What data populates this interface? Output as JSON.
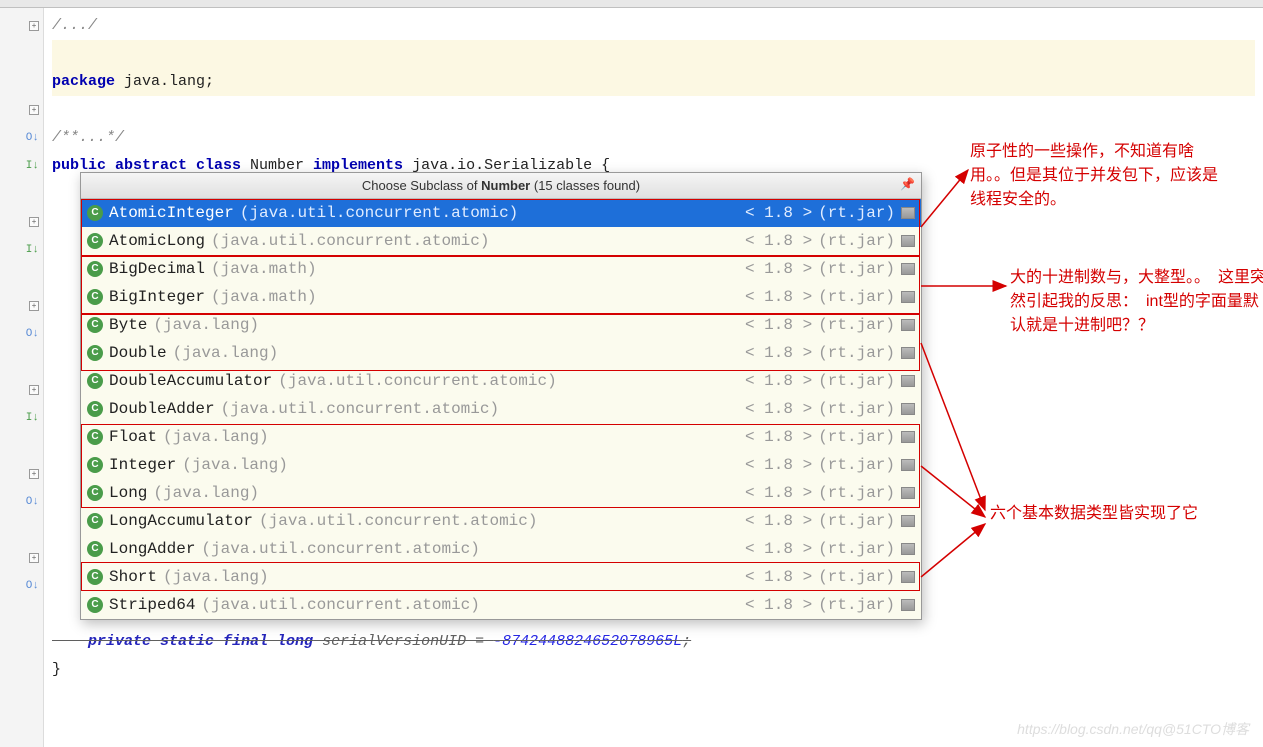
{
  "code": {
    "line1": "/.../",
    "line2_pkg_kw": "package",
    "line2_pkg": " java.lang;",
    "line3": "/**...*/",
    "line4_kw1": "public abstract class",
    "line4_name": " Number ",
    "line4_kw2": "implements",
    "line4_rest": " java.io.Serializable {",
    "line5": "    private static final long serialVersionUID = -8742448824652078965L;",
    "line5_kw": "private static final long",
    "line5_var": " serialVersionUID = ",
    "line5_num": "-8742448824652078965L",
    "line5_tail": ";",
    "line6": "}"
  },
  "popup": {
    "title_prefix": "Choose Subclass of ",
    "title_bold": "Number",
    "title_suffix": " (15 classes found)",
    "items": [
      {
        "name": "AtomicInteger",
        "pkg": "(java.util.concurrent.atomic)",
        "ver": "< 1.8 >",
        "jar": "(rt.jar)",
        "selected": true
      },
      {
        "name": "AtomicLong",
        "pkg": "(java.util.concurrent.atomic)",
        "ver": "< 1.8 >",
        "jar": "(rt.jar)"
      },
      {
        "name": "BigDecimal",
        "pkg": "(java.math)",
        "ver": "< 1.8 >",
        "jar": "(rt.jar)"
      },
      {
        "name": "BigInteger",
        "pkg": "(java.math)",
        "ver": "< 1.8 >",
        "jar": "(rt.jar)"
      },
      {
        "name": "Byte",
        "pkg": "(java.lang)",
        "ver": "< 1.8 >",
        "jar": "(rt.jar)"
      },
      {
        "name": "Double",
        "pkg": "(java.lang)",
        "ver": "< 1.8 >",
        "jar": "(rt.jar)"
      },
      {
        "name": "DoubleAccumulator",
        "pkg": "(java.util.concurrent.atomic)",
        "ver": "< 1.8 >",
        "jar": "(rt.jar)"
      },
      {
        "name": "DoubleAdder",
        "pkg": "(java.util.concurrent.atomic)",
        "ver": "< 1.8 >",
        "jar": "(rt.jar)"
      },
      {
        "name": "Float",
        "pkg": "(java.lang)",
        "ver": "< 1.8 >",
        "jar": "(rt.jar)"
      },
      {
        "name": "Integer",
        "pkg": "(java.lang)",
        "ver": "< 1.8 >",
        "jar": "(rt.jar)"
      },
      {
        "name": "Long",
        "pkg": "(java.lang)",
        "ver": "< 1.8 >",
        "jar": "(rt.jar)"
      },
      {
        "name": "LongAccumulator",
        "pkg": "(java.util.concurrent.atomic)",
        "ver": "< 1.8 >",
        "jar": "(rt.jar)"
      },
      {
        "name": "LongAdder",
        "pkg": "(java.util.concurrent.atomic)",
        "ver": "< 1.8 >",
        "jar": "(rt.jar)"
      },
      {
        "name": "Short",
        "pkg": "(java.lang)",
        "ver": "< 1.8 >",
        "jar": "(rt.jar)"
      },
      {
        "name": "Striped64",
        "pkg": "(java.util.concurrent.atomic)",
        "ver": "< 1.8 >",
        "jar": "(rt.jar)"
      }
    ]
  },
  "annotations": {
    "a1": "原子性的一些操作，不知道有啥用。。但是其位于并发包下，应该是线程安全的。",
    "a2": "大的十进制数与，大整型。。　这里突然引起我的反思：　int型的字面量默认就是十进制吧？？",
    "a3": "六个基本数据类型皆实现了它"
  },
  "watermark": "https://blog.csdn.net/qq@51CTO博客"
}
